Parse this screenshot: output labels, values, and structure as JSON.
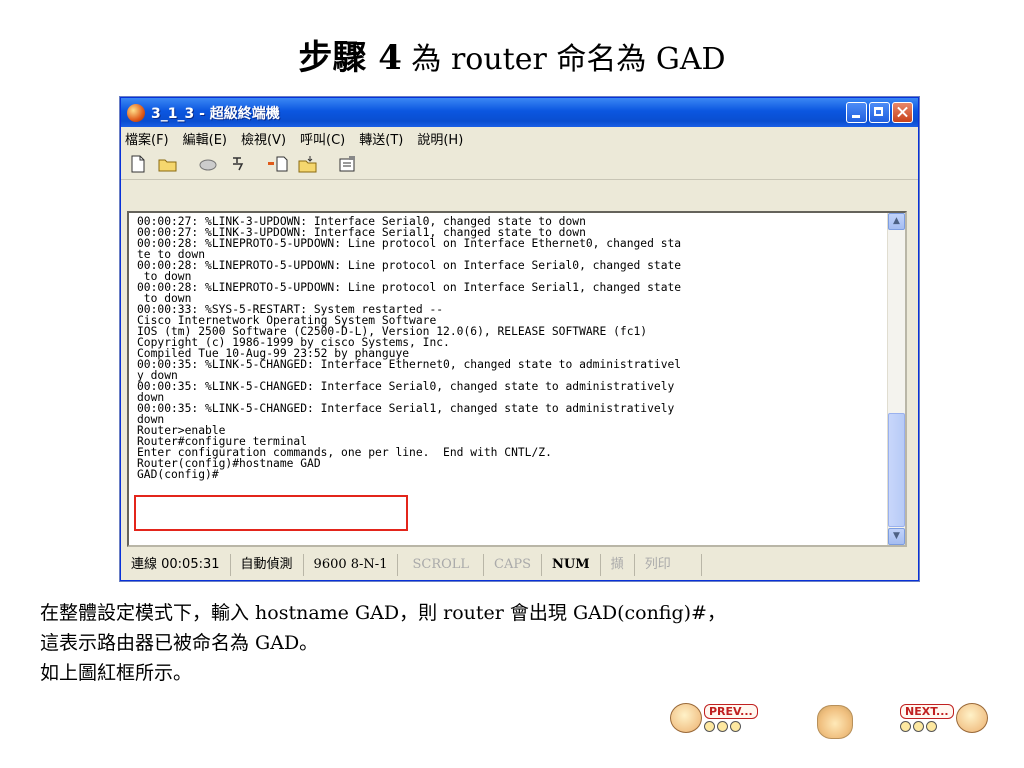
{
  "slide": {
    "title_step": "步驟 4",
    "title_rest": " 為 router 命名為 GAD"
  },
  "window": {
    "title": "3_1_3 - 超級終端機",
    "menu": [
      "檔案(F)",
      "編輯(E)",
      "檢視(V)",
      "呼叫(C)",
      "轉送(T)",
      "說明(H)"
    ]
  },
  "terminal": {
    "lines": [
      "00:00:27: %LINK-3-UPDOWN: Interface Serial0, changed state to down",
      "00:00:27: %LINK-3-UPDOWN: Interface Serial1, changed state to down",
      "00:00:28: %LINEPROTO-5-UPDOWN: Line protocol on Interface Ethernet0, changed sta",
      "te to down",
      "00:00:28: %LINEPROTO-5-UPDOWN: Line protocol on Interface Serial0, changed state",
      " to down",
      "00:00:28: %LINEPROTO-5-UPDOWN: Line protocol on Interface Serial1, changed state",
      " to down",
      "00:00:33: %SYS-5-RESTART: System restarted --",
      "Cisco Internetwork Operating System Software",
      "IOS (tm) 2500 Software (C2500-D-L), Version 12.0(6), RELEASE SOFTWARE (fc1)",
      "Copyright (c) 1986-1999 by cisco Systems, Inc.",
      "Compiled Tue 10-Aug-99 23:52 by phanguye",
      "00:00:35: %LINK-5-CHANGED: Interface Ethernet0, changed state to administrativel",
      "y down",
      "00:00:35: %LINK-5-CHANGED: Interface Serial0, changed state to administratively",
      "down",
      "00:00:35: %LINK-5-CHANGED: Interface Serial1, changed state to administratively",
      "down",
      "Router>enable",
      "Router#configure terminal",
      "Enter configuration commands, one per line.  End with CNTL/Z.",
      "Router(config)#hostname GAD",
      "GAD(config)#"
    ]
  },
  "status": {
    "connect": "連線 00:05:31",
    "detect": "自動偵測",
    "baud": "9600 8-N-1",
    "scroll": "SCROLL",
    "caps": "CAPS",
    "num": "NUM",
    "capture": "擷",
    "print": "列印"
  },
  "description": {
    "line1": "在整體設定模式下，輸入 hostname GAD，則 router 會出現 GAD(config)#，",
    "line2": "這表示路由器已被命名為 GAD。",
    "line3": "如上圖紅框所示。"
  },
  "nav": {
    "prev": "PREV...",
    "next": "NEXT..."
  },
  "colors": {
    "titlebar": "#0b56e0",
    "highlight": "#e3251b",
    "window_bg": "#ece9d8"
  }
}
